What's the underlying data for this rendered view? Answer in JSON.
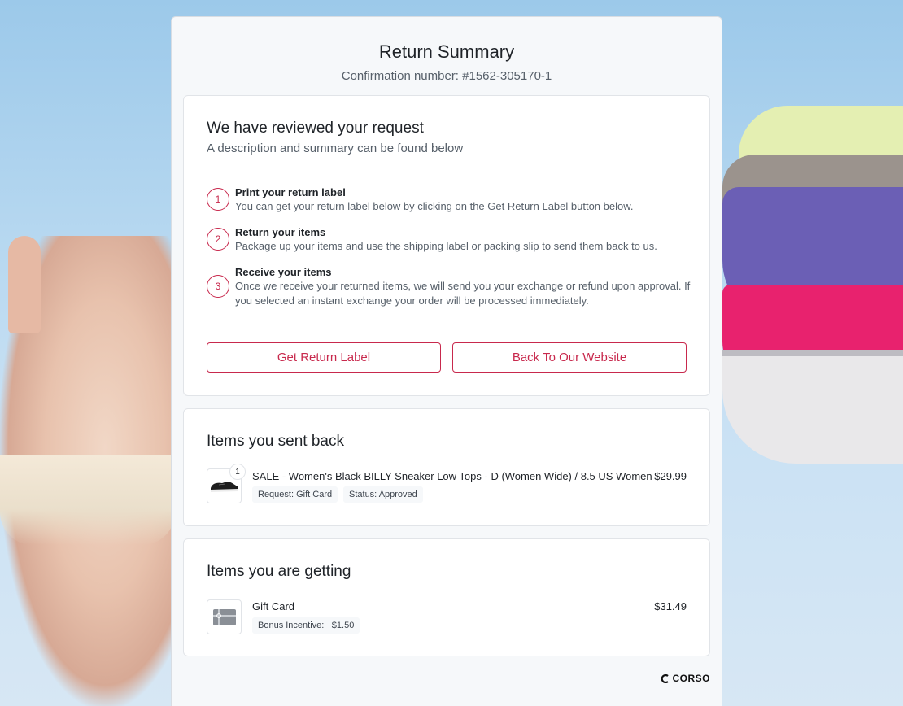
{
  "header": {
    "title": "Return Summary",
    "confirmation": "Confirmation number: #1562-305170-1"
  },
  "review": {
    "title": "We have reviewed your request",
    "description": "A description and summary can be found below",
    "steps": [
      {
        "number": "1",
        "title": "Print your return label",
        "text": "You can get your return label below by clicking on the Get Return Label button below."
      },
      {
        "number": "2",
        "title": "Return your items",
        "text": "Package up your items and use the shipping label or packing slip to send them back to us."
      },
      {
        "number": "3",
        "title": "Receive your items",
        "text": "Once we receive your returned items, we will send you your exchange or refund upon approval. If you selected an instant exchange your order will be processed immediately."
      }
    ],
    "buttons": {
      "get_label": "Get Return Label",
      "back": "Back To Our Website"
    }
  },
  "sent": {
    "title": "Items you sent back",
    "item": {
      "quantity": "1",
      "name": "SALE - Women's Black BILLY Sneaker Low Tops - D (Women Wide) / 8.5 US Women",
      "price": "$29.99",
      "request": "Request: Gift Card",
      "status": "Status: Approved",
      "icon": "sneaker-thumbnail"
    }
  },
  "getting": {
    "title": "Items you are getting",
    "item": {
      "name": "Gift Card",
      "price": "$31.49",
      "bonus": "Bonus Incentive: +$1.50",
      "icon": "gift-card-icon"
    }
  },
  "brand": {
    "name": "CORSO"
  },
  "colors": {
    "accent": "#c8294d",
    "panel": "#f6f8fa"
  }
}
